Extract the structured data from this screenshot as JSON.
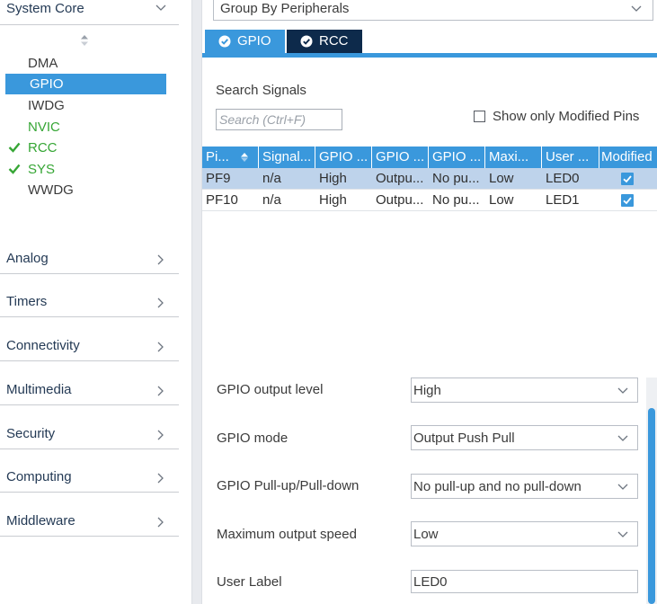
{
  "categories": {
    "system_core": "System Core",
    "items": [
      "Analog",
      "Timers",
      "Connectivity",
      "Multimedia",
      "Security",
      "Computing",
      "Middleware"
    ]
  },
  "system_core_items": [
    {
      "label": "DMA",
      "state": "normal"
    },
    {
      "label": "GPIO",
      "state": "selected"
    },
    {
      "label": "IWDG",
      "state": "normal"
    },
    {
      "label": "NVIC",
      "state": "green"
    },
    {
      "label": "RCC",
      "state": "checked"
    },
    {
      "label": "SYS",
      "state": "checked"
    },
    {
      "label": "WWDG",
      "state": "normal"
    }
  ],
  "group_by": "Group By Peripherals",
  "tabs": [
    {
      "label": "GPIO",
      "active": true
    },
    {
      "label": "RCC",
      "active": false
    }
  ],
  "search": {
    "title": "Search Signals",
    "placeholder": "Search (Ctrl+F)",
    "modified_only_label": "Show only Modified Pins",
    "modified_only_checked": false
  },
  "table": {
    "columns": [
      "Pi...",
      "Signal...",
      "GPIO ...",
      "GPIO ...",
      "GPIO ...",
      "Maxi...",
      "User ...",
      "Modified"
    ],
    "rows": [
      {
        "cells": [
          "PF9",
          "n/a",
          "High",
          "Outpu...",
          "No pu...",
          "Low",
          "LED0"
        ],
        "modified": true,
        "selected": true
      },
      {
        "cells": [
          "PF10",
          "n/a",
          "High",
          "Outpu...",
          "No pu...",
          "Low",
          "LED1"
        ],
        "modified": true,
        "selected": false
      }
    ]
  },
  "config": {
    "output_level": {
      "label": "GPIO output level",
      "value": "High"
    },
    "mode": {
      "label": "GPIO mode",
      "value": "Output Push Pull"
    },
    "pull": {
      "label": "GPIO Pull-up/Pull-down",
      "value": "No pull-up and no pull-down"
    },
    "speed": {
      "label": "Maximum output speed",
      "value": "Low"
    },
    "user_label": {
      "label": "User Label",
      "value": "LED0"
    }
  },
  "colors": {
    "accent": "#3a98dc",
    "tab_dark": "#0d2a4b",
    "green": "#36a635",
    "row_selected": "#bed3eb"
  },
  "icons": [
    "chevron-down-icon",
    "chevron-right-icon",
    "sort-icon",
    "checkmark-icon",
    "check-circle-icon"
  ]
}
